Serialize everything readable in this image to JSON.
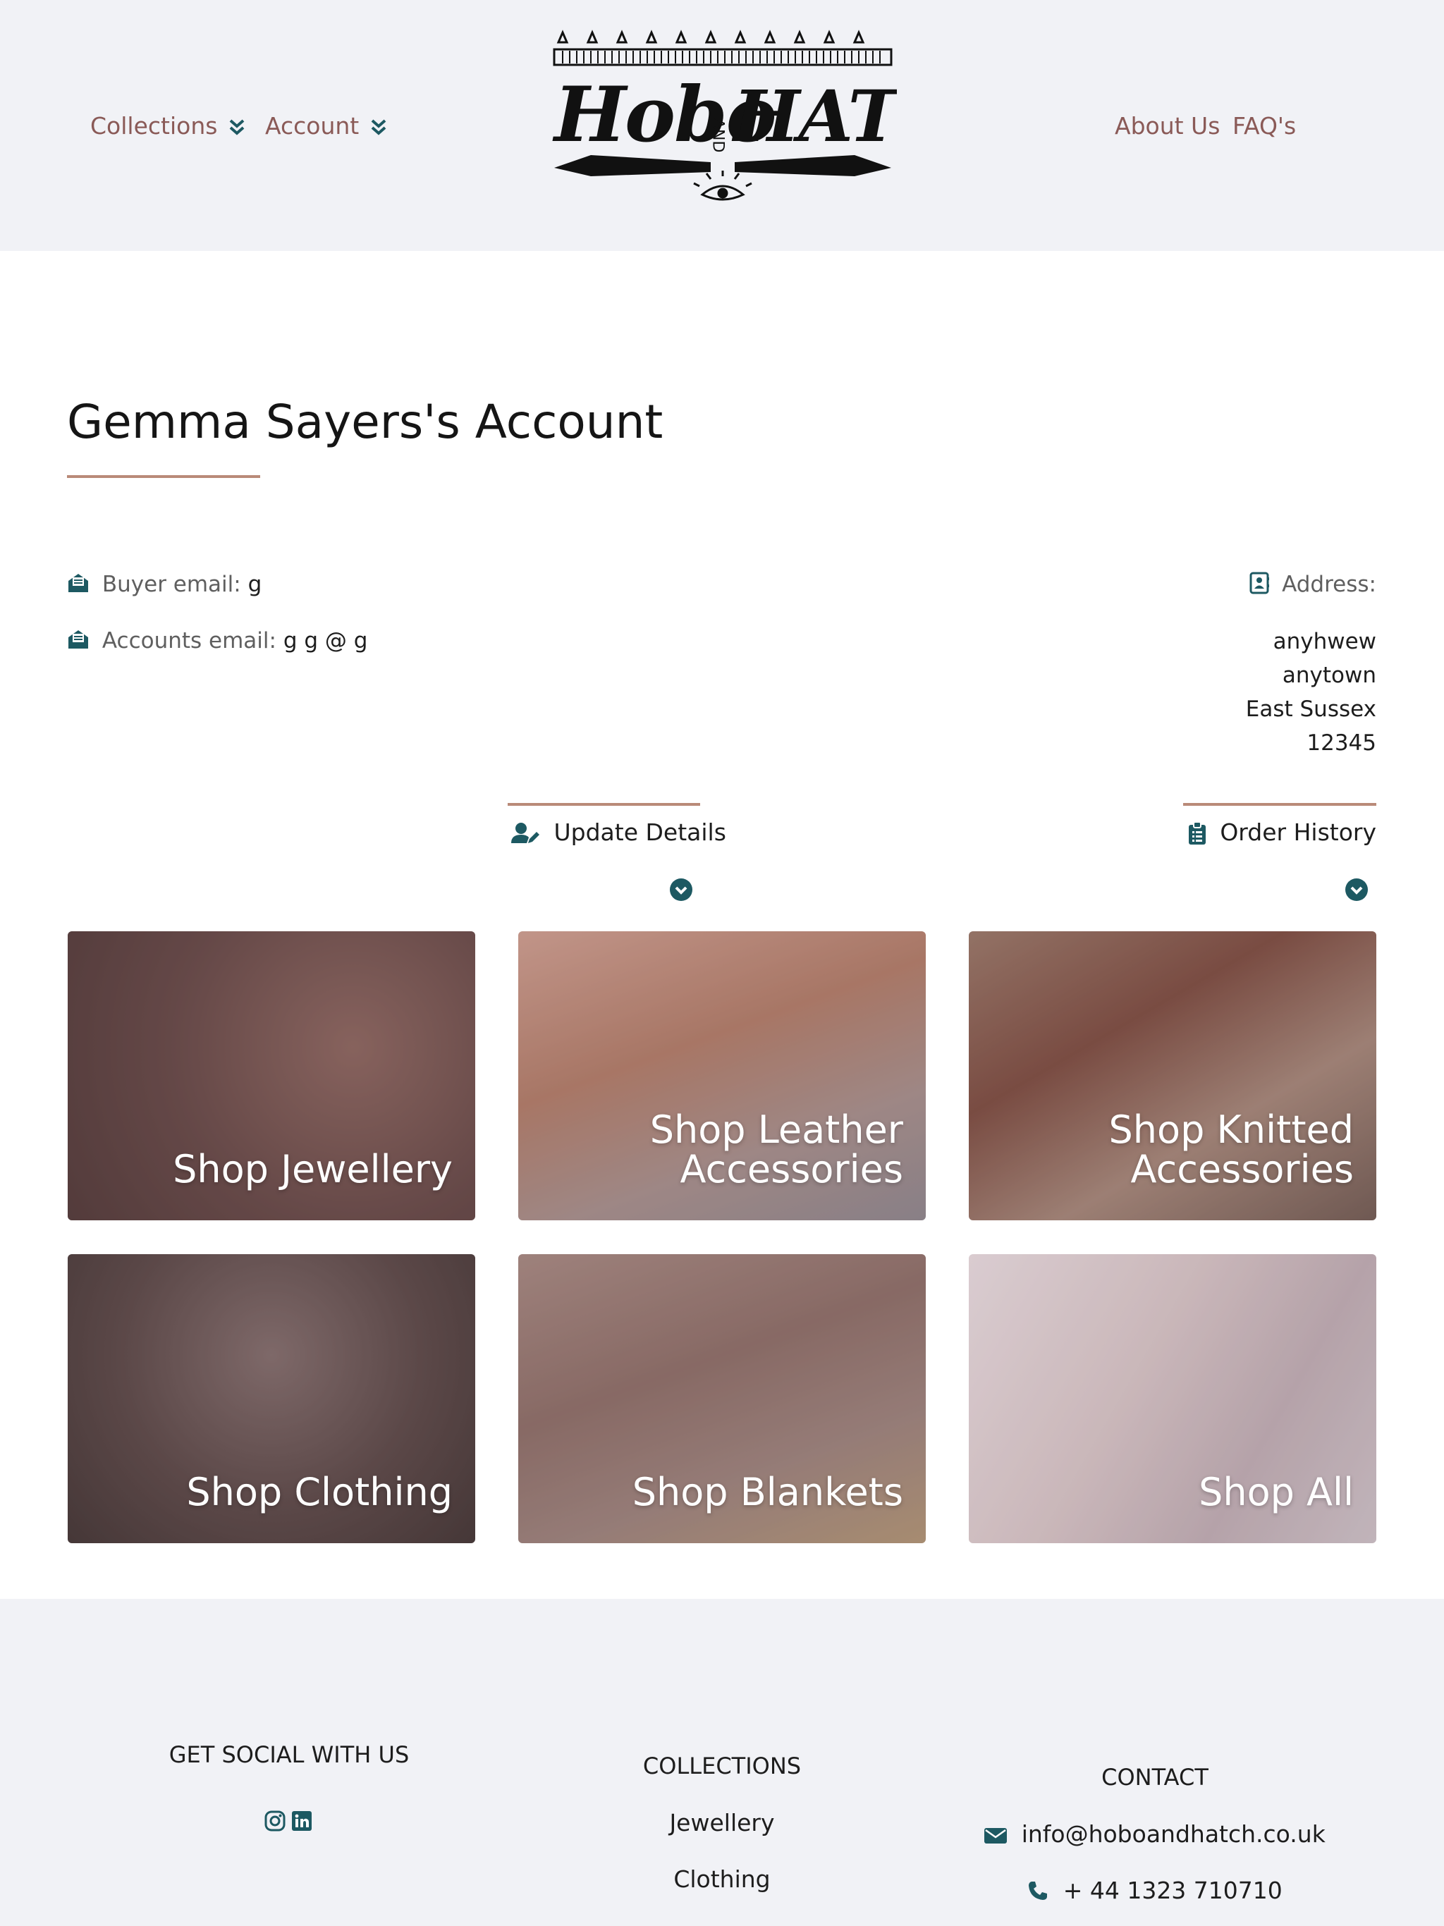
{
  "header": {
    "nav_left": [
      {
        "label": "Collections",
        "icon": "chevron-double-down-icon"
      },
      {
        "label": "Account",
        "icon": "chevron-double-down-icon"
      }
    ],
    "nav_right": [
      {
        "label": "About Us"
      },
      {
        "label": "FAQ's"
      }
    ],
    "logo": {
      "word_left": "Hobo",
      "word_mid": "AND",
      "word_right": "HATCH"
    }
  },
  "account": {
    "title": "Gemma Sayers's Account",
    "buyer_email_label": "Buyer email:",
    "buyer_email_value": "g",
    "accounts_email_label": "Accounts email:",
    "accounts_email_value": "g          g     @ g",
    "address_label": "Address:",
    "address_lines": [
      "anyhwew",
      "anytown",
      "East Sussex",
      "12345"
    ],
    "update_details_label": "Update Details",
    "order_history_label": "Order History"
  },
  "tiles": [
    {
      "label_line1": "Shop Jewellery",
      "label_line2": ""
    },
    {
      "label_line1": "Shop Leather",
      "label_line2": "Accessories"
    },
    {
      "label_line1": "Shop Knitted",
      "label_line2": "Accessories"
    },
    {
      "label_line1": "Shop Clothing",
      "label_line2": ""
    },
    {
      "label_line1": "Shop Blankets",
      "label_line2": ""
    },
    {
      "label_line1": "Shop All",
      "label_line2": ""
    }
  ],
  "footer": {
    "social_heading": "GET SOCIAL WITH US",
    "collections_heading": "COLLECTIONS",
    "collections": [
      "Jewellery",
      "Clothing"
    ],
    "contact_heading": "CONTACT",
    "email": "info@hoboandhatch.co.uk",
    "phone": "+ 44 1323 710710"
  },
  "colors": {
    "accent_teal": "#1d5962",
    "nav_text": "#8a5a57",
    "rule": "#b98a78",
    "header_bg": "#f1f2f6"
  }
}
